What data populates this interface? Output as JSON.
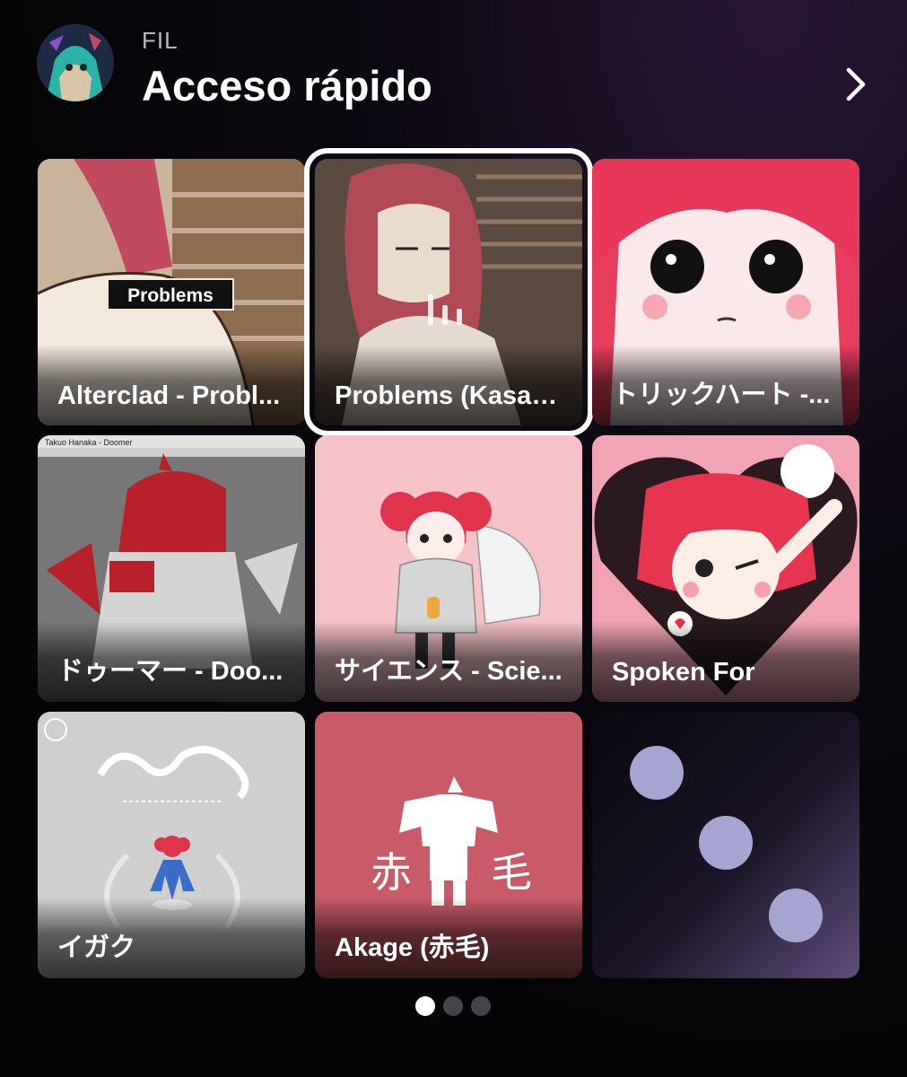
{
  "header": {
    "user_label": "FIL",
    "title": "Acceso rápido",
    "avatar_icon": "avatar",
    "next_icon": "chevron-right-icon"
  },
  "tiles": [
    {
      "label": "Alterclad - Probl...",
      "art_text": "Problems"
    },
    {
      "label": "Problems (Kasan...",
      "playing": true
    },
    {
      "label": "トリックハート -..."
    },
    {
      "label": "ドゥーマー - Doo...",
      "art_text": "Takuo Hanaka - Doomer"
    },
    {
      "label": "サイエンス - Scie..."
    },
    {
      "label": "Spoken For"
    },
    {
      "label": "イガク"
    },
    {
      "label": "Akage (赤毛)",
      "art_text_left": "赤",
      "art_text_right": "毛"
    },
    {
      "label": ""
    }
  ],
  "pagination": {
    "current": 1,
    "total": 3
  },
  "colors": {
    "accent": "#ffffff",
    "dot_inactive": "#444349",
    "background": "#050507"
  }
}
